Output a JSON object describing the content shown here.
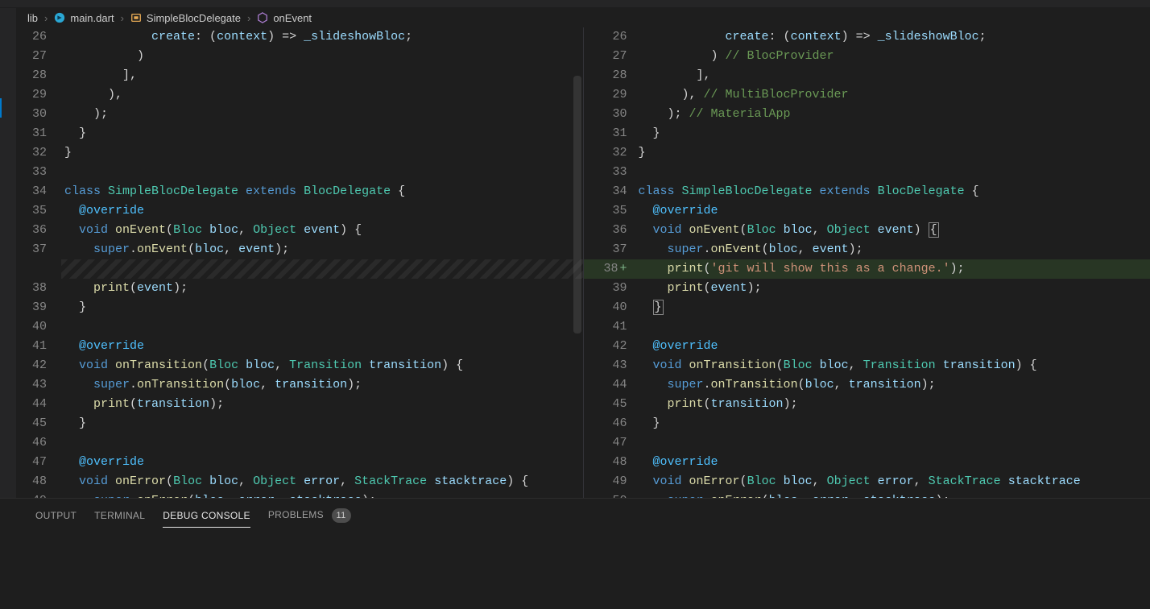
{
  "breadcrumb": {
    "folder": "lib",
    "file": "main.dart",
    "class": "SimpleBlocDelegate",
    "method": "onEvent"
  },
  "panel": {
    "tabs": {
      "output": "OUTPUT",
      "terminal": "TERMINAL",
      "debug": "DEBUG CONSOLE",
      "problems": "PROBLEMS"
    },
    "problems_count": "11",
    "active": "debug"
  },
  "left": {
    "lines": [
      {
        "n": "26",
        "tokens": [
          [
            "",
            "            "
          ],
          [
            "var",
            "create"
          ],
          [
            "punc",
            ": ("
          ],
          [
            "var",
            "context"
          ],
          [
            "punc",
            ") => "
          ],
          [
            "var",
            "_slideshowBloc"
          ],
          [
            "punc",
            ";"
          ]
        ]
      },
      {
        "n": "27",
        "tokens": [
          [
            "",
            "          "
          ],
          [
            "punc",
            ")"
          ]
        ]
      },
      {
        "n": "28",
        "tokens": [
          [
            "",
            "        "
          ],
          [
            "punc",
            "],"
          ]
        ]
      },
      {
        "n": "29",
        "tokens": [
          [
            "",
            "      "
          ],
          [
            "punc",
            "),"
          ]
        ]
      },
      {
        "n": "30",
        "tokens": [
          [
            "",
            "    "
          ],
          [
            "punc",
            ");"
          ]
        ]
      },
      {
        "n": "31",
        "tokens": [
          [
            "",
            "  "
          ],
          [
            "punc",
            "}"
          ]
        ]
      },
      {
        "n": "32",
        "tokens": [
          [
            "punc",
            "}"
          ]
        ]
      },
      {
        "n": "33",
        "tokens": [
          [
            "",
            ""
          ]
        ]
      },
      {
        "n": "34",
        "tokens": [
          [
            "kw",
            "class "
          ],
          [
            "type",
            "SimpleBlocDelegate "
          ],
          [
            "kw",
            "extends "
          ],
          [
            "type",
            "BlocDelegate "
          ],
          [
            "punc",
            "{"
          ]
        ]
      },
      {
        "n": "35",
        "tokens": [
          [
            "",
            "  "
          ],
          [
            "anno",
            "@override"
          ]
        ]
      },
      {
        "n": "36",
        "tokens": [
          [
            "",
            "  "
          ],
          [
            "kw",
            "void "
          ],
          [
            "fn",
            "onEvent"
          ],
          [
            "punc",
            "("
          ],
          [
            "type",
            "Bloc "
          ],
          [
            "var",
            "bloc"
          ],
          [
            "punc",
            ", "
          ],
          [
            "type",
            "Object "
          ],
          [
            "var",
            "event"
          ],
          [
            "punc",
            ") {"
          ]
        ]
      },
      {
        "n": "37",
        "tokens": [
          [
            "",
            "    "
          ],
          [
            "kw",
            "super"
          ],
          [
            "punc",
            "."
          ],
          [
            "fn",
            "onEvent"
          ],
          [
            "punc",
            "("
          ],
          [
            "var",
            "bloc"
          ],
          [
            "punc",
            ", "
          ],
          [
            "var",
            "event"
          ],
          [
            "punc",
            ");"
          ]
        ]
      },
      {
        "n": "",
        "gap": true
      },
      {
        "n": "38",
        "tokens": [
          [
            "",
            "    "
          ],
          [
            "fn",
            "print"
          ],
          [
            "punc",
            "("
          ],
          [
            "var",
            "event"
          ],
          [
            "punc",
            ");"
          ]
        ]
      },
      {
        "n": "39",
        "tokens": [
          [
            "",
            "  "
          ],
          [
            "punc",
            "}"
          ]
        ]
      },
      {
        "n": "40",
        "tokens": [
          [
            "",
            ""
          ]
        ]
      },
      {
        "n": "41",
        "tokens": [
          [
            "",
            "  "
          ],
          [
            "anno",
            "@override"
          ]
        ]
      },
      {
        "n": "42",
        "tokens": [
          [
            "",
            "  "
          ],
          [
            "kw",
            "void "
          ],
          [
            "fn",
            "onTransition"
          ],
          [
            "punc",
            "("
          ],
          [
            "type",
            "Bloc "
          ],
          [
            "var",
            "bloc"
          ],
          [
            "punc",
            ", "
          ],
          [
            "type",
            "Transition "
          ],
          [
            "var",
            "transition"
          ],
          [
            "punc",
            ") {"
          ]
        ]
      },
      {
        "n": "43",
        "tokens": [
          [
            "",
            "    "
          ],
          [
            "kw",
            "super"
          ],
          [
            "punc",
            "."
          ],
          [
            "fn",
            "onTransition"
          ],
          [
            "punc",
            "("
          ],
          [
            "var",
            "bloc"
          ],
          [
            "punc",
            ", "
          ],
          [
            "var",
            "transition"
          ],
          [
            "punc",
            ");"
          ]
        ]
      },
      {
        "n": "44",
        "tokens": [
          [
            "",
            "    "
          ],
          [
            "fn",
            "print"
          ],
          [
            "punc",
            "("
          ],
          [
            "var",
            "transition"
          ],
          [
            "punc",
            ");"
          ]
        ]
      },
      {
        "n": "45",
        "tokens": [
          [
            "",
            "  "
          ],
          [
            "punc",
            "}"
          ]
        ]
      },
      {
        "n": "46",
        "tokens": [
          [
            "",
            ""
          ]
        ]
      },
      {
        "n": "47",
        "tokens": [
          [
            "",
            "  "
          ],
          [
            "anno",
            "@override"
          ]
        ]
      },
      {
        "n": "48",
        "tokens": [
          [
            "",
            "  "
          ],
          [
            "kw",
            "void "
          ],
          [
            "fn",
            "onError"
          ],
          [
            "punc",
            "("
          ],
          [
            "type",
            "Bloc "
          ],
          [
            "var",
            "bloc"
          ],
          [
            "punc",
            ", "
          ],
          [
            "type",
            "Object "
          ],
          [
            "var",
            "error"
          ],
          [
            "punc",
            ", "
          ],
          [
            "type",
            "StackTrace "
          ],
          [
            "var",
            "stacktrace"
          ],
          [
            "punc",
            ") {"
          ]
        ]
      },
      {
        "n": "49",
        "tokens": [
          [
            "",
            "    "
          ],
          [
            "kw",
            "super"
          ],
          [
            "punc",
            "."
          ],
          [
            "fn",
            "onError"
          ],
          [
            "punc",
            "("
          ],
          [
            "var",
            "bloc"
          ],
          [
            "punc",
            ", "
          ],
          [
            "var",
            "error"
          ],
          [
            "punc",
            ", "
          ],
          [
            "var",
            "stacktrace"
          ],
          [
            "punc",
            ");"
          ]
        ]
      }
    ]
  },
  "right": {
    "added_index": 12,
    "lines": [
      {
        "n": "26",
        "tokens": [
          [
            "",
            "            "
          ],
          [
            "var",
            "create"
          ],
          [
            "punc",
            ": ("
          ],
          [
            "var",
            "context"
          ],
          [
            "punc",
            ") => "
          ],
          [
            "var",
            "_slideshowBloc"
          ],
          [
            "punc",
            ";"
          ]
        ]
      },
      {
        "n": "27",
        "tokens": [
          [
            "",
            "          "
          ],
          [
            "punc",
            ") "
          ],
          [
            "cmt",
            "// BlocProvider"
          ]
        ]
      },
      {
        "n": "28",
        "tokens": [
          [
            "",
            "        "
          ],
          [
            "punc",
            "],"
          ]
        ]
      },
      {
        "n": "29",
        "tokens": [
          [
            "",
            "      "
          ],
          [
            "punc",
            "), "
          ],
          [
            "cmt",
            "// MultiBlocProvider"
          ]
        ]
      },
      {
        "n": "30",
        "tokens": [
          [
            "",
            "    "
          ],
          [
            "punc",
            "); "
          ],
          [
            "cmt",
            "// MaterialApp"
          ]
        ]
      },
      {
        "n": "31",
        "tokens": [
          [
            "",
            "  "
          ],
          [
            "punc",
            "}"
          ]
        ]
      },
      {
        "n": "32",
        "tokens": [
          [
            "punc",
            "}"
          ]
        ]
      },
      {
        "n": "33",
        "tokens": [
          [
            "",
            ""
          ]
        ]
      },
      {
        "n": "34",
        "tokens": [
          [
            "kw",
            "class "
          ],
          [
            "type",
            "SimpleBlocDelegate "
          ],
          [
            "kw",
            "extends "
          ],
          [
            "type",
            "BlocDelegate "
          ],
          [
            "punc",
            "{"
          ]
        ]
      },
      {
        "n": "35",
        "tokens": [
          [
            "",
            "  "
          ],
          [
            "anno",
            "@override"
          ]
        ]
      },
      {
        "n": "36",
        "tokens": [
          [
            "",
            "  "
          ],
          [
            "kw",
            "void "
          ],
          [
            "fn",
            "onEvent"
          ],
          [
            "punc",
            "("
          ],
          [
            "type",
            "Bloc "
          ],
          [
            "var",
            "bloc"
          ],
          [
            "punc",
            ", "
          ],
          [
            "type",
            "Object "
          ],
          [
            "var",
            "event"
          ],
          [
            "punc",
            ") "
          ]
        ],
        "box_after": true
      },
      {
        "n": "37",
        "tokens": [
          [
            "",
            "    "
          ],
          [
            "kw",
            "super"
          ],
          [
            "punc",
            "."
          ],
          [
            "fn",
            "onEvent"
          ],
          [
            "punc",
            "("
          ],
          [
            "var",
            "bloc"
          ],
          [
            "punc",
            ", "
          ],
          [
            "var",
            "event"
          ],
          [
            "punc",
            ");"
          ]
        ]
      },
      {
        "n": "38",
        "plus": true,
        "tokens": [
          [
            "",
            "    "
          ],
          [
            "fn",
            "print"
          ],
          [
            "punc",
            "("
          ],
          [
            "str",
            "'git will show this as a change.'"
          ],
          [
            "punc",
            ");"
          ]
        ]
      },
      {
        "n": "39",
        "tokens": [
          [
            "",
            "    "
          ],
          [
            "fn",
            "print"
          ],
          [
            "punc",
            "("
          ],
          [
            "var",
            "event"
          ],
          [
            "punc",
            ");"
          ]
        ]
      },
      {
        "n": "40",
        "tokens": [
          [
            "",
            "  "
          ]
        ],
        "box_after": true,
        "box_at_indent": true
      },
      {
        "n": "41",
        "tokens": [
          [
            "",
            ""
          ]
        ]
      },
      {
        "n": "42",
        "tokens": [
          [
            "",
            "  "
          ],
          [
            "anno",
            "@override"
          ]
        ]
      },
      {
        "n": "43",
        "tokens": [
          [
            "",
            "  "
          ],
          [
            "kw",
            "void "
          ],
          [
            "fn",
            "onTransition"
          ],
          [
            "punc",
            "("
          ],
          [
            "type",
            "Bloc "
          ],
          [
            "var",
            "bloc"
          ],
          [
            "punc",
            ", "
          ],
          [
            "type",
            "Transition "
          ],
          [
            "var",
            "transition"
          ],
          [
            "punc",
            ") {"
          ]
        ]
      },
      {
        "n": "44",
        "tokens": [
          [
            "",
            "    "
          ],
          [
            "kw",
            "super"
          ],
          [
            "punc",
            "."
          ],
          [
            "fn",
            "onTransition"
          ],
          [
            "punc",
            "("
          ],
          [
            "var",
            "bloc"
          ],
          [
            "punc",
            ", "
          ],
          [
            "var",
            "transition"
          ],
          [
            "punc",
            ");"
          ]
        ]
      },
      {
        "n": "45",
        "tokens": [
          [
            "",
            "    "
          ],
          [
            "fn",
            "print"
          ],
          [
            "punc",
            "("
          ],
          [
            "var",
            "transition"
          ],
          [
            "punc",
            ");"
          ]
        ]
      },
      {
        "n": "46",
        "tokens": [
          [
            "",
            "  "
          ],
          [
            "punc",
            "}"
          ]
        ]
      },
      {
        "n": "47",
        "tokens": [
          [
            "",
            ""
          ]
        ]
      },
      {
        "n": "48",
        "tokens": [
          [
            "",
            "  "
          ],
          [
            "anno",
            "@override"
          ]
        ]
      },
      {
        "n": "49",
        "tokens": [
          [
            "",
            "  "
          ],
          [
            "kw",
            "void "
          ],
          [
            "fn",
            "onError"
          ],
          [
            "punc",
            "("
          ],
          [
            "type",
            "Bloc "
          ],
          [
            "var",
            "bloc"
          ],
          [
            "punc",
            ", "
          ],
          [
            "type",
            "Object "
          ],
          [
            "var",
            "error"
          ],
          [
            "punc",
            ", "
          ],
          [
            "type",
            "StackTrace "
          ],
          [
            "var",
            "stacktrace"
          ]
        ]
      },
      {
        "n": "50",
        "tokens": [
          [
            "",
            "    "
          ],
          [
            "kw",
            "super"
          ],
          [
            "punc",
            "."
          ],
          [
            "fn",
            "onError"
          ],
          [
            "punc",
            "("
          ],
          [
            "var",
            "bloc"
          ],
          [
            "punc",
            ", "
          ],
          [
            "var",
            "error"
          ],
          [
            "punc",
            ", "
          ],
          [
            "var",
            "stacktrace"
          ],
          [
            "punc",
            ");"
          ]
        ]
      }
    ]
  }
}
